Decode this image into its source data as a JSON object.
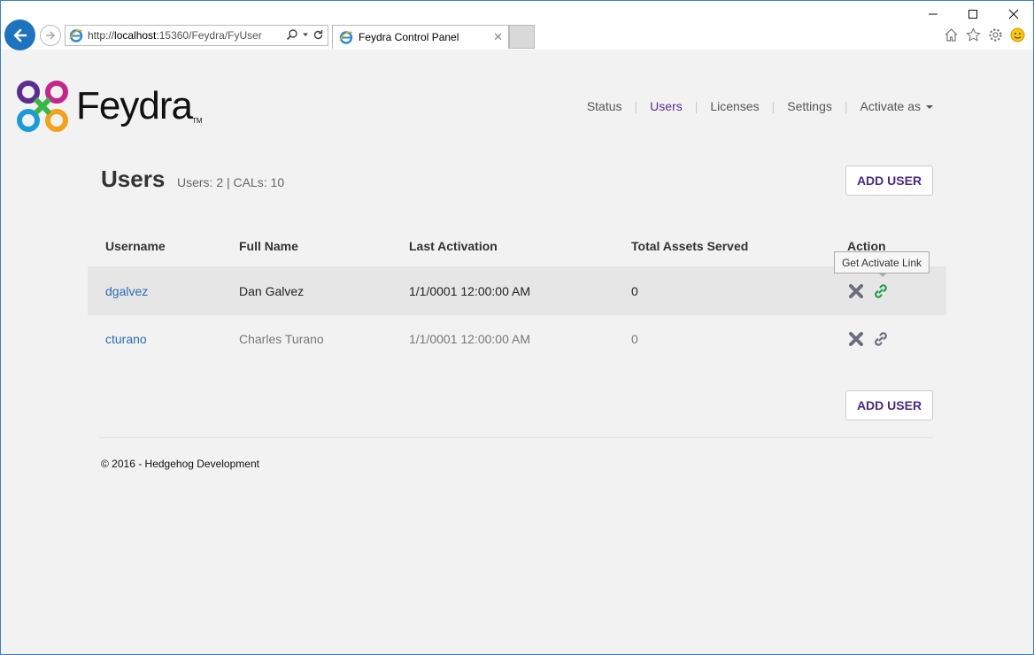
{
  "browser": {
    "url_prefix": "http://",
    "url_host": "localhost",
    "url_path": ":15360/Feydra/FyUser",
    "tab_title": "Feydra Control Panel"
  },
  "logo": {
    "text": "Feydra",
    "tm": "TM"
  },
  "nav": {
    "items": [
      "Status",
      "Users",
      "Licenses",
      "Settings",
      "Activate as"
    ],
    "active_index": 1
  },
  "page": {
    "title": "Users",
    "subtitle": "Users: 2 | CALs: 10",
    "add_user_label": "ADD USER"
  },
  "table": {
    "headers": [
      "Username",
      "Full Name",
      "Last Activation",
      "Total Assets Served",
      "Action"
    ],
    "rows": [
      {
        "username": "dgalvez",
        "full_name": "Dan Galvez",
        "last_activation": "1/1/0001 12:00:00 AM",
        "total_assets": "0"
      },
      {
        "username": "cturano",
        "full_name": "Charles Turano",
        "last_activation": "1/1/0001 12:00:00 AM",
        "total_assets": "0"
      }
    ],
    "tooltip": "Get Activate Link"
  },
  "footer": {
    "text": "© 2016 - Hedgehog Development"
  },
  "colors": {
    "accent": "#5b2d8e",
    "link": "#2a6db3",
    "link_icon_active": "#22a04b",
    "icon_gray": "#6a6e7a"
  }
}
